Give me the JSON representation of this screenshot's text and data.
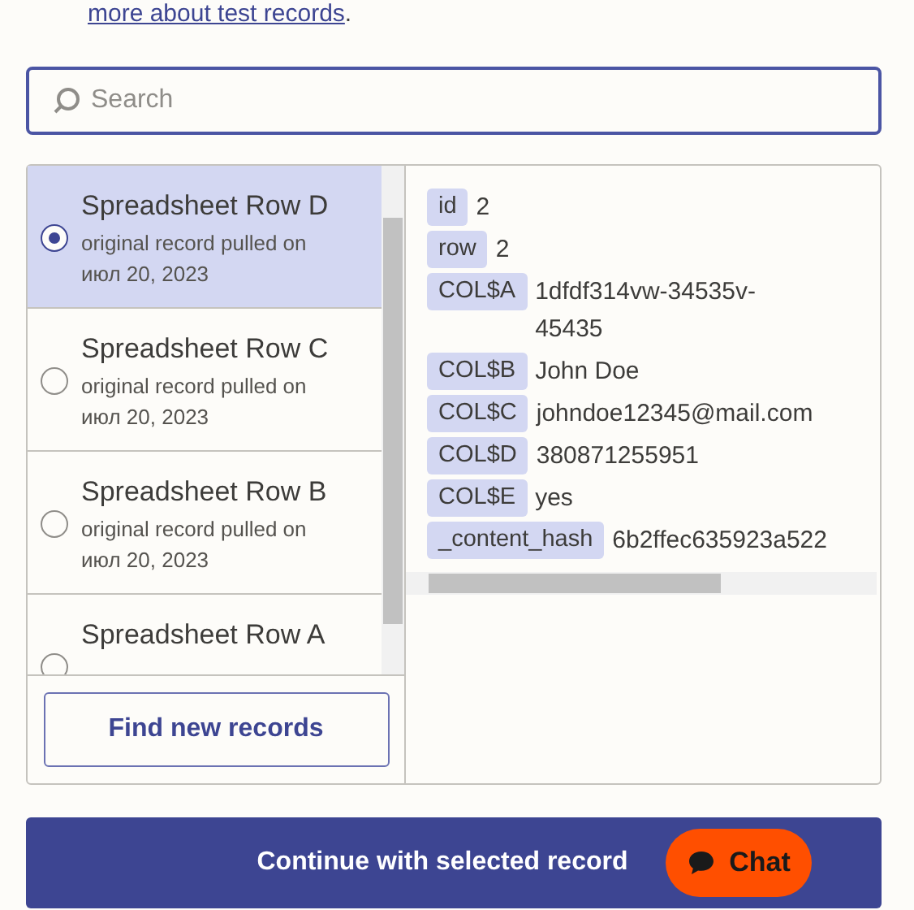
{
  "intro": {
    "link": "more about test records",
    "tail": "."
  },
  "search": {
    "placeholder": "Search"
  },
  "records": [
    {
      "title": "Spreadsheet Row D",
      "subtitle": "original record pulled on",
      "date": "июл 20, 2023",
      "selected": true
    },
    {
      "title": "Spreadsheet Row C",
      "subtitle": "original record pulled on",
      "date": "июл 20, 2023",
      "selected": false
    },
    {
      "title": "Spreadsheet Row B",
      "subtitle": "original record pulled on",
      "date": "июл 20, 2023",
      "selected": false
    },
    {
      "title": "Spreadsheet Row A",
      "selected": false
    }
  ],
  "find_button": "Find new records",
  "fields": [
    {
      "key": "id",
      "value": "2"
    },
    {
      "key": "row",
      "value": "2"
    },
    {
      "key": "COL$A",
      "value": "1dfdf314vw-34535v-45435"
    },
    {
      "key": "COL$B",
      "value": "John Doe"
    },
    {
      "key": "COL$C",
      "value": "johndoe12345@mail.com"
    },
    {
      "key": "COL$D",
      "value": "380871255951"
    },
    {
      "key": "COL$E",
      "value": "yes"
    },
    {
      "key": "_content_hash",
      "value": "6b2ffec635923a522"
    }
  ],
  "continue_button": "Continue with selected record",
  "chat_button": "Chat"
}
